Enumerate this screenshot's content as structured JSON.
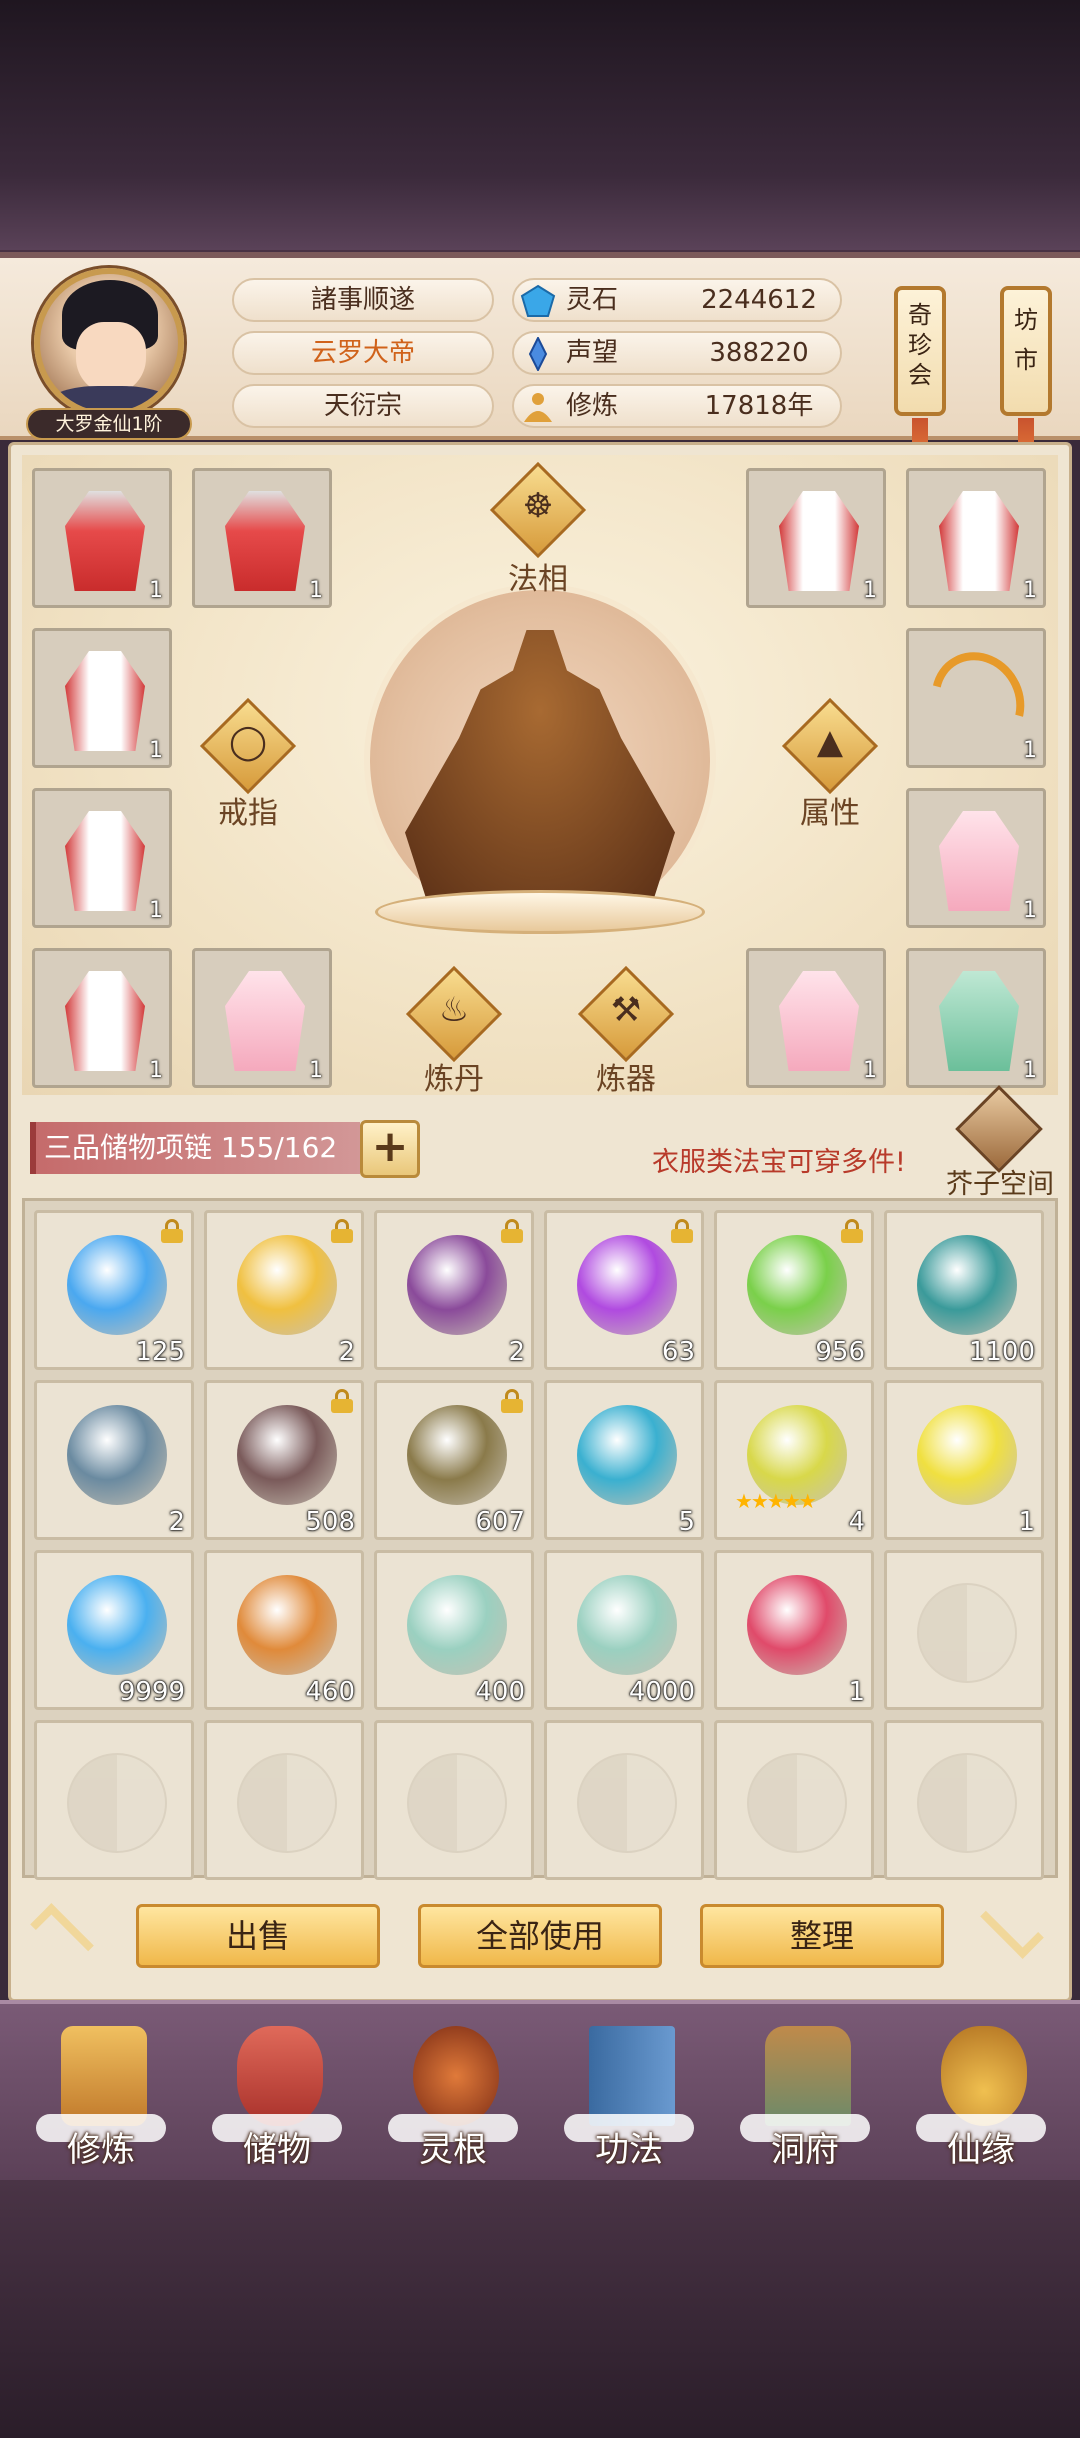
{
  "player": {
    "rank": "大罗金仙1阶",
    "motto": "諸事顺遂",
    "title": "云罗大帝",
    "sect": "天衍宗"
  },
  "stats": [
    {
      "label": "灵石",
      "value": "2244612",
      "icon": "spirit-stone-icon",
      "color": "#3aa7e8"
    },
    {
      "label": "声望",
      "value": "388220",
      "icon": "prestige-crystal-icon",
      "color": "#4a8be0"
    },
    {
      "label": "修炼",
      "value": "17818年",
      "icon": "cultivation-icon",
      "color": "#e0a03a"
    }
  ],
  "side_buttons": [
    {
      "label": "奇珍会"
    },
    {
      "label": "坊市"
    }
  ],
  "equipment": {
    "labels": {
      "dharma": "法相",
      "ring": "戒指",
      "attribute": "属性",
      "alchemy": "炼丹",
      "forge": "炼器"
    },
    "slots": [
      {
        "count": "1",
        "kind": "red"
      },
      {
        "count": "1",
        "kind": "red"
      },
      {
        "count": "1",
        "kind": "redwhite"
      },
      {
        "count": "1",
        "kind": "redwhite"
      },
      {
        "count": "1",
        "kind": "redwhite"
      },
      {
        "count": "1",
        "kind": "bow"
      },
      {
        "count": "1",
        "kind": "redwhite"
      },
      {
        "count": "1",
        "kind": "pink"
      },
      {
        "count": "1",
        "kind": "redwhite"
      },
      {
        "count": "1",
        "kind": "pink"
      },
      {
        "count": "1",
        "kind": "pink"
      },
      {
        "count": "1",
        "kind": "green"
      }
    ]
  },
  "storage": {
    "name": "三品储物项链 155/162",
    "add_label": "+",
    "hint": "衣服类法宝可穿多件!",
    "space_label": "芥子空间"
  },
  "inventory": [
    {
      "count": "125",
      "locked": true,
      "color": "#4aa8f0",
      "icon": "water-orb-icon"
    },
    {
      "count": "2",
      "locked": true,
      "color": "#f0c040",
      "icon": "golden-talisman-icon"
    },
    {
      "count": "2",
      "locked": true,
      "color": "#8a4a9a",
      "icon": "purple-orb-icon"
    },
    {
      "count": "63",
      "locked": true,
      "color": "#b04ae0",
      "icon": "violet-orb-icon"
    },
    {
      "count": "956",
      "locked": true,
      "color": "#7ad04a",
      "icon": "spirit-grass-icon"
    },
    {
      "count": "1100",
      "locked": false,
      "color": "#3a9a9a",
      "icon": "scroll-icon"
    },
    {
      "count": "2",
      "locked": false,
      "color": "#6a8aa0",
      "icon": "scroll-icon"
    },
    {
      "count": "508",
      "locked": true,
      "color": "#7a5a5a",
      "icon": "ore-icon"
    },
    {
      "count": "607",
      "locked": true,
      "color": "#8a7a4a",
      "icon": "ore-icon"
    },
    {
      "count": "5",
      "locked": false,
      "color": "#3ab0d0",
      "icon": "crystal-ball-icon"
    },
    {
      "count": "4",
      "locked": false,
      "color": "#d8d84a",
      "icon": "golden-pearl-icon",
      "stars": "★★★★★"
    },
    {
      "count": "1",
      "locked": false,
      "color": "#f0e040",
      "icon": "yellow-gem-icon"
    },
    {
      "count": "9999",
      "locked": false,
      "color": "#4ab0f0",
      "icon": "blue-crystal-icon"
    },
    {
      "count": "460",
      "locked": false,
      "color": "#e08a3a",
      "icon": "lotus-pod-icon"
    },
    {
      "count": "400",
      "locked": false,
      "color": "#9ad0c0",
      "icon": "sword-icon"
    },
    {
      "count": "4000",
      "locked": false,
      "color": "#9ad0c0",
      "icon": "sword-icon"
    },
    {
      "count": "1",
      "locked": false,
      "color": "#e04a6a",
      "icon": "scroll-icon"
    }
  ],
  "actions": {
    "sell": "出售",
    "use_all": "全部使用",
    "sort": "整理"
  },
  "nav": [
    {
      "label": "修炼",
      "icon": "meditating-monk-icon",
      "color": "#e0a040"
    },
    {
      "label": "储物",
      "icon": "storage-bag-icon",
      "color": "#d0504a"
    },
    {
      "label": "灵根",
      "icon": "spirit-root-icon",
      "color": "#c06030"
    },
    {
      "label": "功法",
      "icon": "skill-book-icon",
      "color": "#4a7ab0"
    },
    {
      "label": "洞府",
      "icon": "cave-dwelling-icon",
      "color": "#a07040"
    },
    {
      "label": "仙缘",
      "icon": "immortal-gourd-icon",
      "color": "#e0b040"
    }
  ]
}
